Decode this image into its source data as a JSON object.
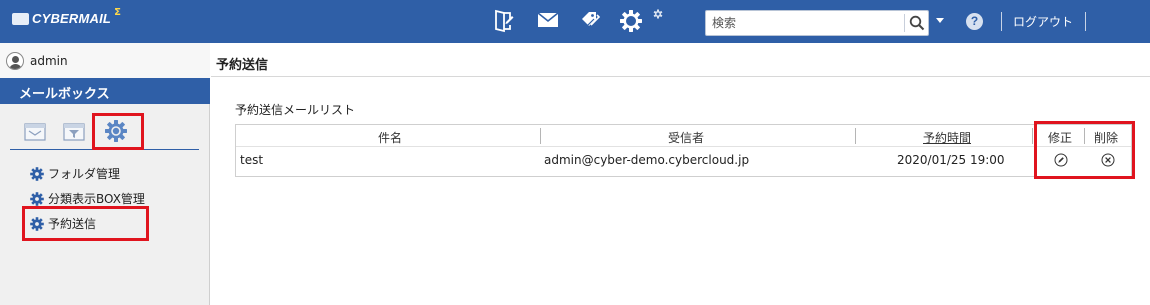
{
  "app": {
    "logo_text": "CYBERMAIL",
    "logo_superscript": "Σ"
  },
  "header": {
    "search_placeholder": "検索",
    "help_label": "?",
    "logout_label": "ログアウト",
    "icons": [
      "compose-icon",
      "mail-icon",
      "address-book-icon",
      "settings-icon",
      "search-icon",
      "help-icon"
    ]
  },
  "user": {
    "name": "admin"
  },
  "sidebar": {
    "section_title": "メールボックス",
    "tabs": [
      "mailbox-tab",
      "filter-tab",
      "settings-tab"
    ],
    "menu": [
      {
        "label": "フォルダ管理"
      },
      {
        "label": "分類表示BOX管理"
      },
      {
        "label": "予約送信"
      }
    ]
  },
  "main": {
    "title": "予約送信",
    "list_title": "予約送信メールリスト",
    "columns": [
      "件名",
      "受信者",
      "予約時間",
      "修正",
      "削除"
    ],
    "rows": [
      {
        "subject": "test",
        "recipient": "admin@cyber-demo.cybercloud.jp",
        "scheduled": "2020/01/25 19:00"
      }
    ]
  },
  "colors": {
    "topbar": "#2f5fa7",
    "highlight": "#e0141e",
    "icon_blue": "#2f5fa7"
  }
}
